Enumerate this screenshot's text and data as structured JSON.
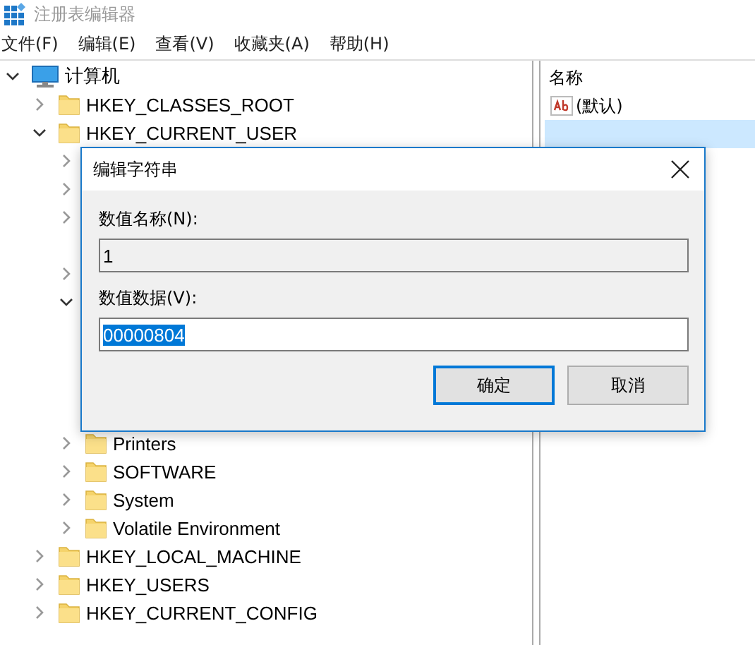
{
  "window": {
    "title": "注册表编辑器"
  },
  "menu": [
    "文件(F)",
    "编辑(E)",
    "查看(V)",
    "收藏夹(A)",
    "帮助(H)"
  ],
  "tree": [
    {
      "label": "计算机",
      "kind": "computer",
      "expanded": true,
      "children": [
        {
          "label": "HKEY_CLASSES_ROOT",
          "kind": "folder",
          "expanded": false
        },
        {
          "label": "HKEY_CURRENT_USER",
          "kind": "folder",
          "expanded": true,
          "children": [
            {
              "kind": "hidden",
              "expanded": false
            },
            {
              "kind": "hidden",
              "expanded": false
            },
            {
              "kind": "hidden",
              "expanded": false
            },
            {
              "kind": "blank"
            },
            {
              "kind": "hidden",
              "expanded": false
            },
            {
              "kind": "hidden",
              "expanded": true
            },
            {
              "kind": "blank"
            },
            {
              "kind": "blank"
            },
            {
              "kind": "blank"
            },
            {
              "kind": "blank"
            },
            {
              "label": "Printers",
              "kind": "folder",
              "expanded": false
            },
            {
              "label": "SOFTWARE",
              "kind": "folder",
              "expanded": false
            },
            {
              "label": "System",
              "kind": "folder",
              "expanded": false
            },
            {
              "label": "Volatile Environment",
              "kind": "folder",
              "expanded": false
            }
          ]
        },
        {
          "label": "HKEY_LOCAL_MACHINE",
          "kind": "folder",
          "expanded": false
        },
        {
          "label": "HKEY_USERS",
          "kind": "folder",
          "expanded": false
        },
        {
          "label": "HKEY_CURRENT_CONFIG",
          "kind": "folder",
          "expanded": false
        }
      ]
    }
  ],
  "values": {
    "column": "名称",
    "rows": [
      {
        "name": "(默认)",
        "selected": false
      },
      {
        "selected": true
      }
    ]
  },
  "dialog": {
    "title": "编辑字符串",
    "name_label": "数值名称(N):",
    "name_value": "1",
    "data_label": "数值数据(V):",
    "data_value": "00000804",
    "buttons": [
      {
        "label": "确定",
        "default": true
      },
      {
        "label": "取消",
        "default": false
      }
    ]
  }
}
